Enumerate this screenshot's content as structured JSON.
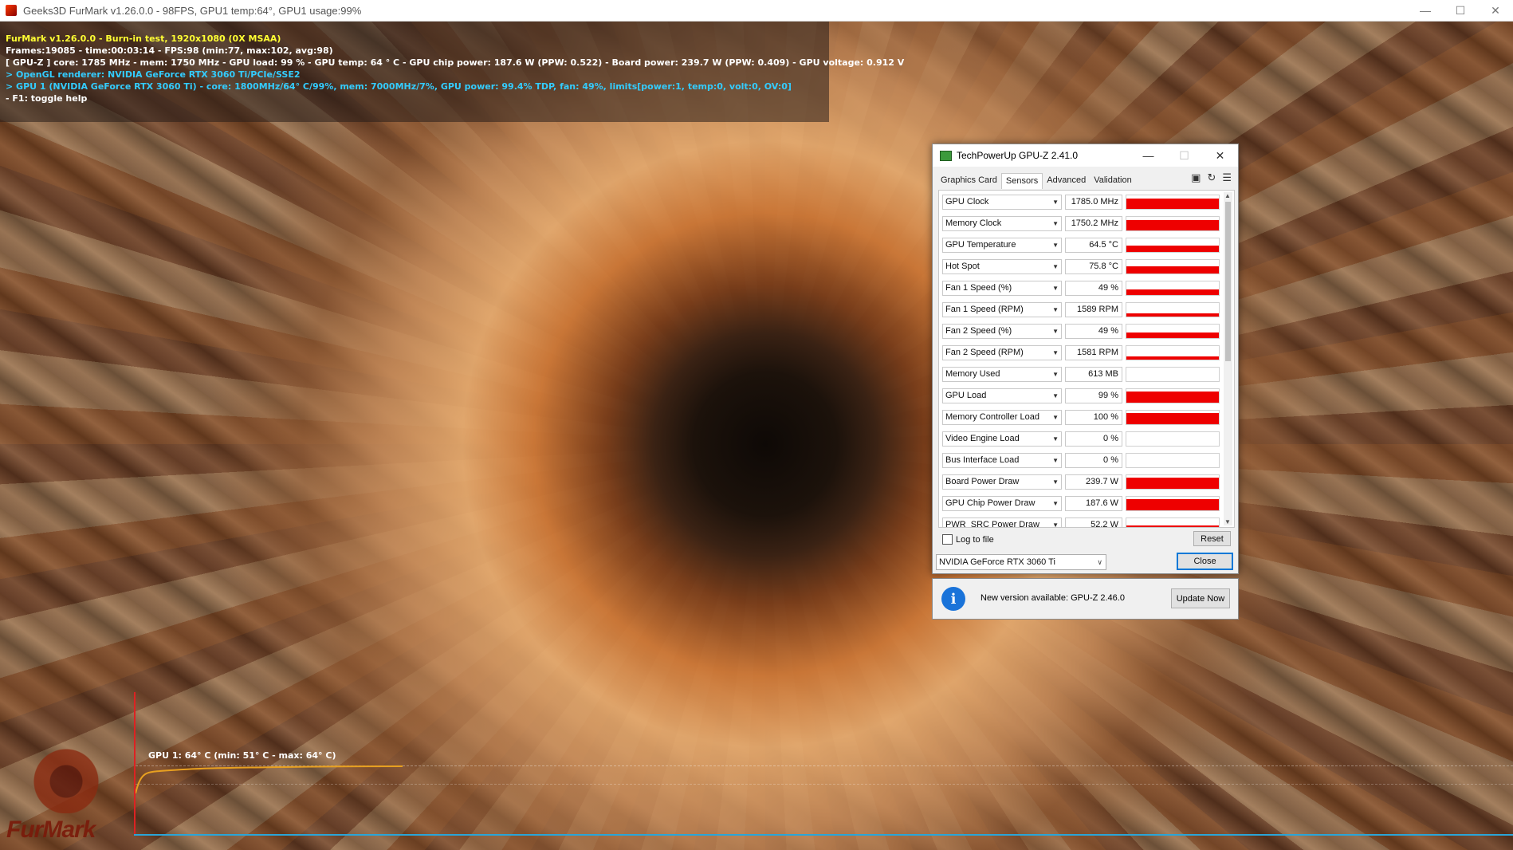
{
  "furmark": {
    "window_title": "Geeks3D FurMark v1.26.0.0 - 98FPS, GPU1 temp:64°, GPU1 usage:99%",
    "overlay_lines": [
      {
        "text": "FurMark v1.26.0.0 - Burn-in test, 1920x1080 (0X MSAA)",
        "color": "#ffff33"
      },
      {
        "text": "Frames:19085 - time:00:03:14 - FPS:98 (min:77, max:102, avg:98)",
        "color": "#ffffff"
      },
      {
        "text": "[ GPU-Z ] core: 1785 MHz - mem: 1750 MHz - GPU load: 99 % - GPU temp: 64 ° C - GPU chip power: 187.6 W (PPW: 0.522) - Board power: 239.7 W (PPW: 0.409) - GPU voltage: 0.912 V",
        "color": "#ffffff"
      },
      {
        "text": "> OpenGL renderer: NVIDIA GeForce RTX 3060 Ti/PCIe/SSE2",
        "color": "#33ccff"
      },
      {
        "text": "> GPU 1 (NVIDIA GeForce RTX 3060 Ti) - core: 1800MHz/64° C/99%, mem: 7000MHz/7%, GPU power: 99.4% TDP, fan: 49%, limits[power:1, temp:0, volt:0, OV:0]",
        "color": "#33ccff"
      },
      {
        "text": "- F1: toggle help",
        "color": "#ffffff"
      }
    ],
    "graph_label": "GPU 1: 64° C (min: 51° C - max: 64° C)",
    "logo_text": "FurMark"
  },
  "gpuz": {
    "title": "TechPowerUp GPU-Z 2.41.0",
    "tabs": [
      "Graphics Card",
      "Sensors",
      "Advanced",
      "Validation"
    ],
    "active_tab": "Sensors",
    "sensors": [
      {
        "name": "GPU Clock",
        "value": "1785.0 MHz",
        "level": 0.78
      },
      {
        "name": "Memory Clock",
        "value": "1750.2 MHz",
        "level": 0.78
      },
      {
        "name": "GPU Temperature",
        "value": "64.5 °C",
        "level": 0.45
      },
      {
        "name": "Hot Spot",
        "value": "75.8 °C",
        "level": 0.55
      },
      {
        "name": "Fan 1 Speed (%)",
        "value": "49 %",
        "level": 0.4
      },
      {
        "name": "Fan 1 Speed (RPM)",
        "value": "1589 RPM",
        "level": 0.22
      },
      {
        "name": "Fan 2 Speed (%)",
        "value": "49 %",
        "level": 0.4
      },
      {
        "name": "Fan 2 Speed (RPM)",
        "value": "1581 RPM",
        "level": 0.22
      },
      {
        "name": "Memory Used",
        "value": "613 MB",
        "level": 0.0
      },
      {
        "name": "GPU Load",
        "value": "99 %",
        "level": 0.8
      },
      {
        "name": "Memory Controller Load",
        "value": "100 %",
        "level": 0.8
      },
      {
        "name": "Video Engine Load",
        "value": "0 %",
        "level": 0.0
      },
      {
        "name": "Bus Interface Load",
        "value": "0 %",
        "level": 0.0
      },
      {
        "name": "Board Power Draw",
        "value": "239.7 W",
        "level": 0.8
      },
      {
        "name": "GPU Chip Power Draw",
        "value": "187.6 W",
        "level": 0.8
      },
      {
        "name": "PWR_SRC Power Draw",
        "value": "52.2 W",
        "level": 0.5
      }
    ],
    "log_to_file": "Log to file",
    "reset_label": "Reset",
    "device_select": "NVIDIA GeForce RTX 3060 Ti",
    "close_label": "Close",
    "update_message": "New version available: GPU-Z 2.46.0",
    "update_button": "Update Now",
    "bar_color": "#ee0000"
  }
}
